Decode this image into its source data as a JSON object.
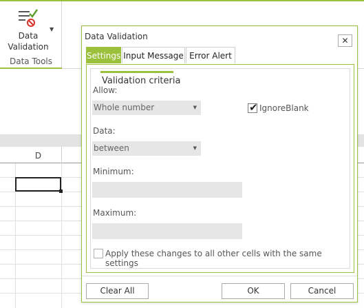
{
  "ribbon": {
    "data_validation_label": "Data Validation",
    "group_title": "Data Tools",
    "icon": "data-validation-icon",
    "accent_color": "#9bc03b"
  },
  "sheet": {
    "column_header": "D"
  },
  "dialog": {
    "title": "Data Validation",
    "close_label": "✕",
    "tabs": [
      {
        "label": "Settings",
        "active": true
      },
      {
        "label": "Input Message",
        "active": false
      },
      {
        "label": "Error Alert",
        "active": false
      }
    ],
    "criteria_title": "Validation criteria",
    "allow_label": "Allow:",
    "allow_value": "Whole number",
    "ignore_blank_label": "IgnoreBlank",
    "ignore_blank_checked": true,
    "data_label": "Data:",
    "data_value": "between",
    "minimum_label": "Minimum:",
    "minimum_value": "",
    "maximum_label": "Maximum:",
    "maximum_value": "",
    "apply_all_label": "Apply these changes to all other cells with the same settings",
    "apply_all_checked": false,
    "buttons": {
      "clear_all": "Clear All",
      "ok": "OK",
      "cancel": "Cancel"
    }
  }
}
